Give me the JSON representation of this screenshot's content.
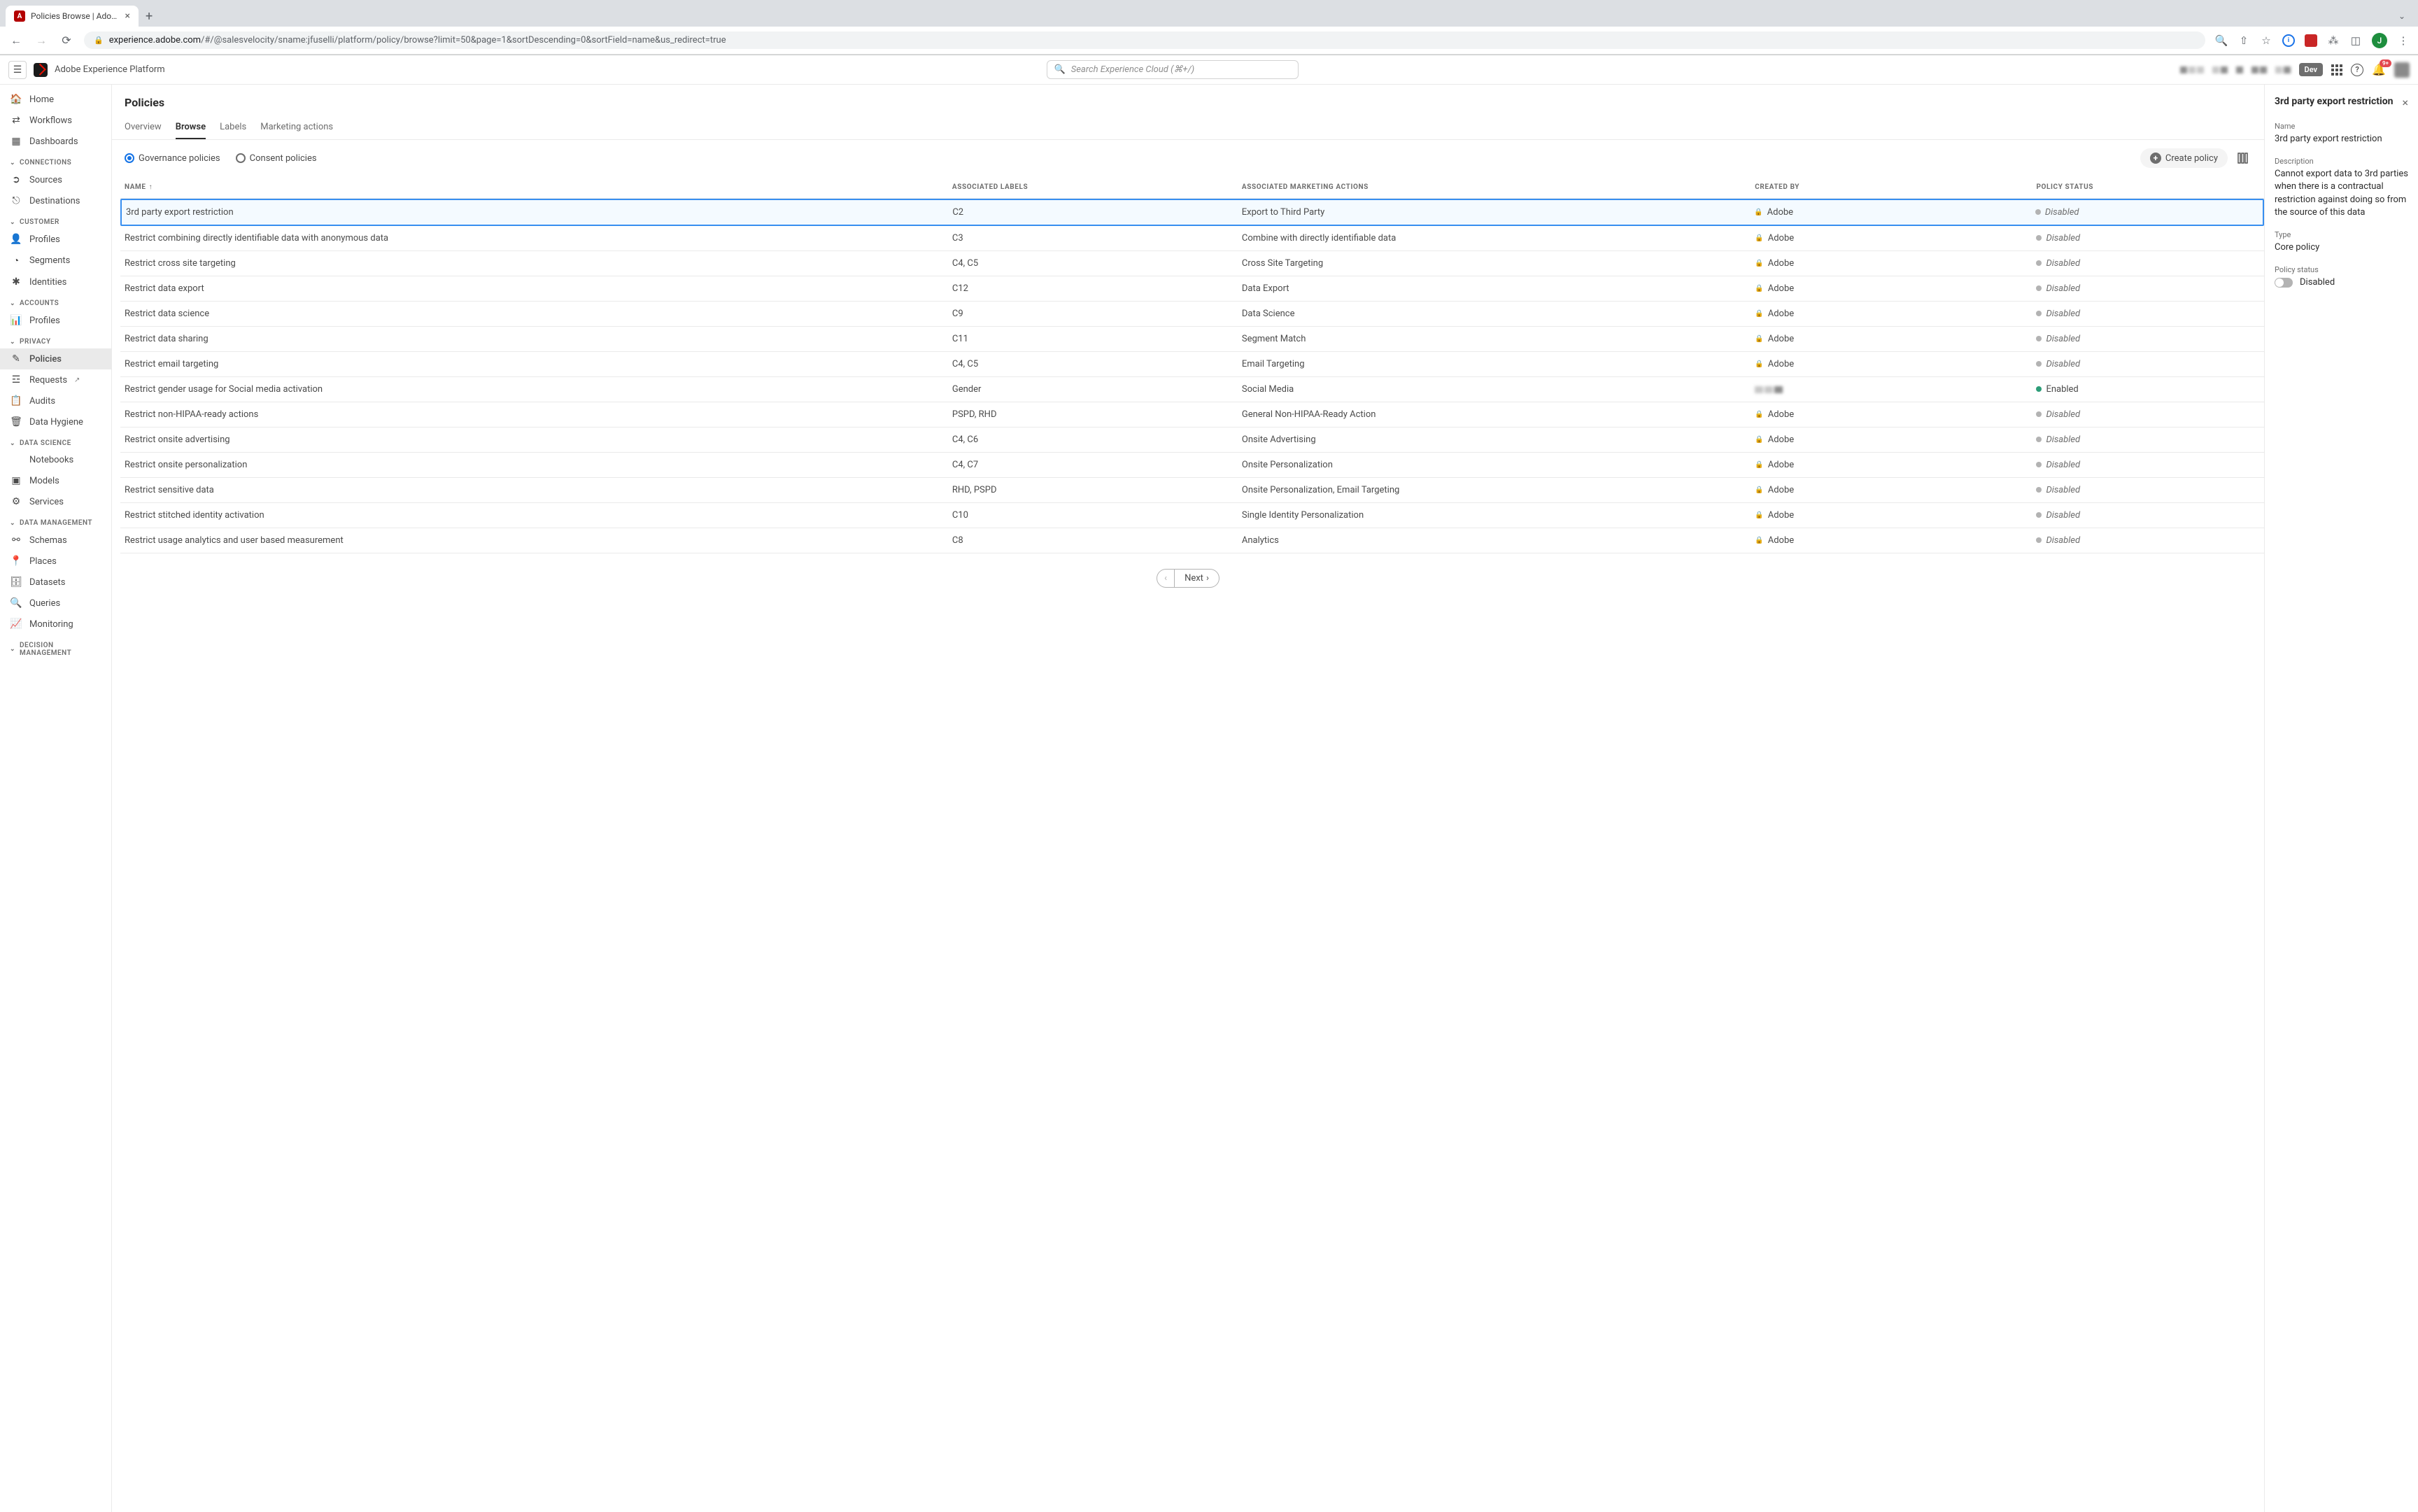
{
  "browser": {
    "tab_title": "Policies Browse | Adobe Experi",
    "url_domain": "experience.adobe.com",
    "url_path": "/#/@salesvelocity/sname:jfuselli/platform/policy/browse?limit=50&page=1&sortDescending=0&sortField=name&us_redirect=true",
    "avatar_letter": "J"
  },
  "header": {
    "app_title": "Adobe Experience Platform",
    "search_placeholder": "Search Experience Cloud (⌘+/)",
    "dev_label": "Dev",
    "notif_count": "9+"
  },
  "sidebar": {
    "top": [
      {
        "icon": "home",
        "label": "Home"
      },
      {
        "icon": "workflow",
        "label": "Workflows"
      },
      {
        "icon": "dashboard",
        "label": "Dashboards"
      }
    ],
    "groups": [
      {
        "title": "CONNECTIONS",
        "items": [
          {
            "icon": "sources",
            "label": "Sources"
          },
          {
            "icon": "dest",
            "label": "Destinations"
          }
        ]
      },
      {
        "title": "CUSTOMER",
        "items": [
          {
            "icon": "profile",
            "label": "Profiles"
          },
          {
            "icon": "segment",
            "label": "Segments"
          },
          {
            "icon": "identity",
            "label": "Identities"
          }
        ]
      },
      {
        "title": "ACCOUNTS",
        "items": [
          {
            "icon": "profiles2",
            "label": "Profiles"
          }
        ]
      },
      {
        "title": "PRIVACY",
        "items": [
          {
            "icon": "policies",
            "label": "Policies",
            "active": true
          },
          {
            "icon": "requests",
            "label": "Requests",
            "ext": true
          },
          {
            "icon": "audits",
            "label": "Audits"
          },
          {
            "icon": "hygiene",
            "label": "Data Hygiene"
          }
        ]
      },
      {
        "title": "DATA SCIENCE",
        "items": [
          {
            "icon": "notebook",
            "label": "Notebooks"
          },
          {
            "icon": "models",
            "label": "Models"
          },
          {
            "icon": "services",
            "label": "Services"
          }
        ]
      },
      {
        "title": "DATA MANAGEMENT",
        "items": [
          {
            "icon": "schemas",
            "label": "Schemas"
          },
          {
            "icon": "places",
            "label": "Places"
          },
          {
            "icon": "datasets",
            "label": "Datasets"
          },
          {
            "icon": "queries",
            "label": "Queries"
          },
          {
            "icon": "monitoring",
            "label": "Monitoring"
          }
        ]
      },
      {
        "title": "DECISION MANAGEMENT",
        "items": []
      }
    ]
  },
  "page": {
    "title": "Policies",
    "tabs": [
      "Overview",
      "Browse",
      "Labels",
      "Marketing actions"
    ],
    "active_tab": "Browse",
    "radio_governance": "Governance policies",
    "radio_consent": "Consent policies",
    "create_btn": "Create policy",
    "columns": [
      "NAME",
      "ASSOCIATED LABELS",
      "ASSOCIATED MARKETING ACTIONS",
      "CREATED BY",
      "POLICY STATUS"
    ],
    "next_label": "Next"
  },
  "rows": [
    {
      "name": "3rd party export restriction",
      "labels": "C2",
      "actions": "Export to Third Party",
      "creator": "Adobe",
      "status": "Disabled",
      "selected": true
    },
    {
      "name": "Restrict combining directly identifiable data with anonymous data",
      "labels": "C3",
      "actions": "Combine with directly identifiable data",
      "creator": "Adobe",
      "status": "Disabled"
    },
    {
      "name": "Restrict cross site targeting",
      "labels": "C4, C5",
      "actions": "Cross Site Targeting",
      "creator": "Adobe",
      "status": "Disabled"
    },
    {
      "name": "Restrict data export",
      "labels": "C12",
      "actions": "Data Export",
      "creator": "Adobe",
      "status": "Disabled"
    },
    {
      "name": "Restrict data science",
      "labels": "C9",
      "actions": "Data Science",
      "creator": "Adobe",
      "status": "Disabled"
    },
    {
      "name": "Restrict data sharing",
      "labels": "C11",
      "actions": "Segment Match",
      "creator": "Adobe",
      "status": "Disabled"
    },
    {
      "name": "Restrict email targeting",
      "labels": "C4, C5",
      "actions": "Email Targeting",
      "creator": "Adobe",
      "status": "Disabled"
    },
    {
      "name": "Restrict gender usage for Social media activation",
      "labels": "Gender",
      "actions": "Social Media",
      "creator": "blur",
      "status": "Enabled"
    },
    {
      "name": "Restrict non-HIPAA-ready actions",
      "labels": "PSPD, RHD",
      "actions": "General Non-HIPAA-Ready Action",
      "creator": "Adobe",
      "status": "Disabled"
    },
    {
      "name": "Restrict onsite advertising",
      "labels": "C4, C6",
      "actions": "Onsite Advertising",
      "creator": "Adobe",
      "status": "Disabled"
    },
    {
      "name": "Restrict onsite personalization",
      "labels": "C4, C7",
      "actions": "Onsite Personalization",
      "creator": "Adobe",
      "status": "Disabled"
    },
    {
      "name": "Restrict sensitive data",
      "labels": "RHD, PSPD",
      "actions": "Onsite Personalization, Email Targeting",
      "creator": "Adobe",
      "status": "Disabled"
    },
    {
      "name": "Restrict stitched identity activation",
      "labels": "C10",
      "actions": "Single Identity Personalization",
      "creator": "Adobe",
      "status": "Disabled"
    },
    {
      "name": "Restrict usage analytics and user based measurement",
      "labels": "C8",
      "actions": "Analytics",
      "creator": "Adobe",
      "status": "Disabled"
    }
  ],
  "detail": {
    "title": "3rd party export restriction",
    "name_label": "Name",
    "name_value": "3rd party export restriction",
    "desc_label": "Description",
    "desc_value": "Cannot export data to 3rd parties when there is a contractual restriction against doing so from the source of this data",
    "type_label": "Type",
    "type_value": "Core policy",
    "status_label": "Policy status",
    "status_value": "Disabled"
  }
}
